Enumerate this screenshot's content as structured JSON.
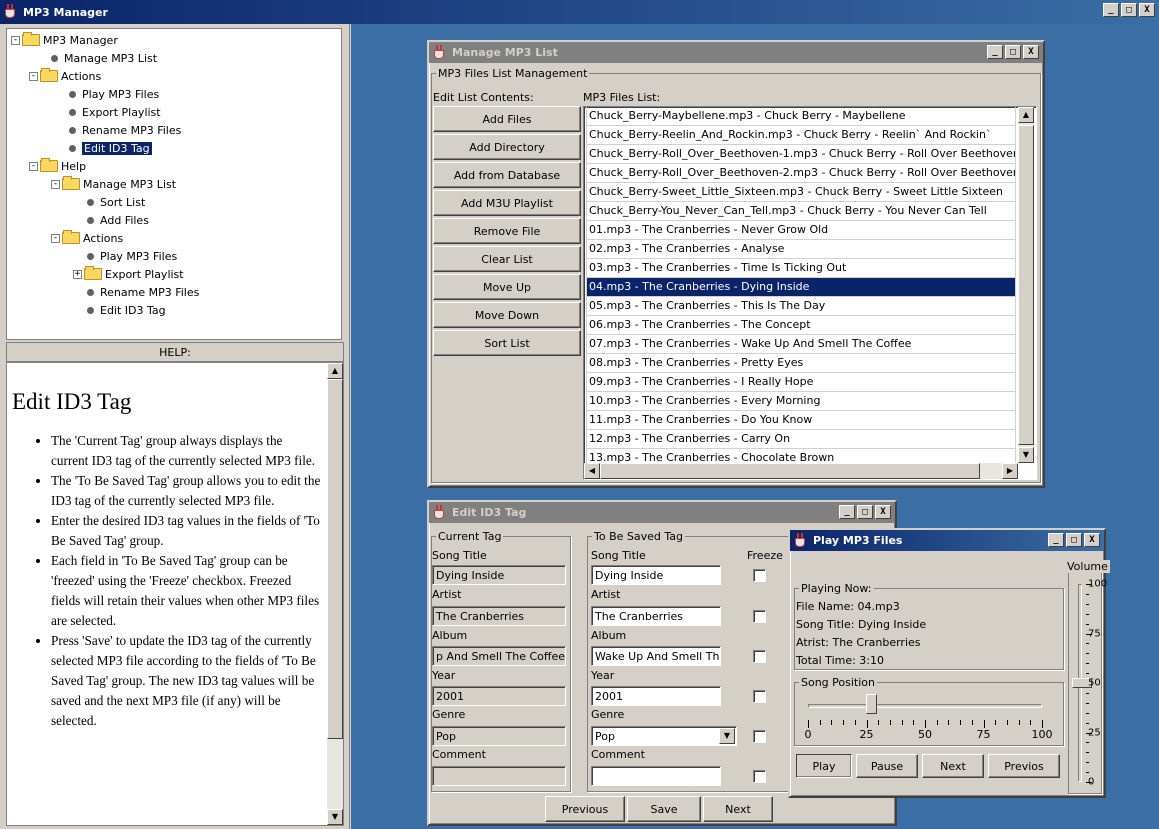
{
  "app": {
    "title": "MP3 Manager",
    "controls": [
      "_",
      "□",
      "X"
    ]
  },
  "tree": {
    "root": "MP3 Manager",
    "items": [
      "Manage MP3 List",
      "Actions",
      "Play MP3 Files",
      "Export Playlist",
      "Rename MP3 Files",
      "Edit ID3 Tag",
      "Help",
      "Manage MP3 List",
      "Sort List",
      "Add Files",
      "Actions",
      "Play MP3 Files",
      "Export Playlist",
      "Rename MP3 Files",
      "Edit ID3 Tag"
    ],
    "expander_minus": "-",
    "expander_plus": "+"
  },
  "help": {
    "header": "HELP:",
    "heading": "Edit ID3 Tag",
    "bullets": [
      "The 'Current Tag' group always displays the current ID3 tag of the currently selected MP3 file.",
      "The 'To Be Saved Tag' group allows you to edit the ID3 tag of the currently selected MP3 file.",
      "Enter the desired ID3 tag values in the fields of 'To Be Saved Tag' group.",
      "Each field in 'To Be Saved Tag' group can be 'freezed' using the 'Freeze' checkbox. Freezed fields will retain their values when other MP3 files are selected.",
      "Press 'Save' to update the ID3 tag of the currently selected MP3 file according to the fields of 'To Be Saved Tag' group. The new ID3 tag values will be saved and the next MP3 file (if any) will be selected."
    ]
  },
  "manage": {
    "title": "Manage MP3 List",
    "group_label": "MP3 Files List Management",
    "edit_label": "Edit List Contents:",
    "list_label": "MP3 Files List:",
    "buttons": [
      "Add Files",
      "Add Directory",
      "Add from Database",
      "Add M3U Playlist",
      "Remove File",
      "Clear List",
      "Move Up",
      "Move Down",
      "Sort List"
    ],
    "files": [
      "Chuck_Berry-Maybellene.mp3 - Chuck Berry - Maybellene",
      "Chuck_Berry-Reelin_And_Rockin.mp3 - Chuck Berry - Reelin` And Rockin`",
      "Chuck_Berry-Roll_Over_Beethoven-1.mp3 - Chuck Berry - Roll Over Beethover",
      "Chuck_Berry-Roll_Over_Beethoven-2.mp3 - Chuck Berry - Roll Over Beethover",
      "Chuck_Berry-Sweet_Little_Sixteen.mp3 - Chuck Berry - Sweet Little Sixteen",
      "Chuck_Berry-You_Never_Can_Tell.mp3 - Chuck Berry - You Never Can Tell",
      "01.mp3 - The Cranberries - Never Grow Old",
      "02.mp3 - The Cranberries - Analyse",
      "03.mp3 - The Cranberries - Time Is Ticking Out",
      "04.mp3 - The Cranberries - Dying Inside",
      "05.mp3 - The Cranberries - This Is The Day",
      "06.mp3 - The Cranberries - The Concept",
      "07.mp3 - The Cranberries - Wake Up And Smell The Coffee",
      "08.mp3 - The Cranberries - Pretty Eyes",
      "09.mp3 - The Cranberries - I Really Hope",
      "10.mp3 - The Cranberries - Every Morning",
      "11.mp3 - The Cranberries - Do You Know",
      "12.mp3 - The Cranberries - Carry On",
      "13.mp3 - The Cranberries - Chocolate Brown"
    ],
    "selected_index": 9
  },
  "id3": {
    "title": "Edit ID3 Tag",
    "current_group": "Current Tag",
    "saved_group": "To Be Saved Tag",
    "freeze_label": "Freeze",
    "fields": [
      {
        "label": "Song Title",
        "current": "Dying Inside",
        "saved": "Dying Inside"
      },
      {
        "label": "Artist",
        "current": "The Cranberries",
        "saved": "The Cranberries"
      },
      {
        "label": "Album",
        "current": "p And Smell The Coffee",
        "saved": "Wake Up And Smell The"
      },
      {
        "label": "Year",
        "current": "2001",
        "saved": "2001"
      },
      {
        "label": "Genre",
        "current": "Pop",
        "saved": "Pop"
      },
      {
        "label": "Comment",
        "current": "",
        "saved": ""
      }
    ],
    "buttons": [
      "Previous",
      "Save",
      "Next"
    ]
  },
  "player": {
    "title": "Play MP3 Files",
    "playing_group": "Playing Now:",
    "file_name": "File Name: 04.mp3",
    "song_title": "Song Title: Dying Inside",
    "artist": "Atrist: The Cranberries",
    "total_time": "Total Time: 3:10",
    "position_group": "Song Position",
    "position_ticks": [
      "0",
      "25",
      "50",
      "75",
      "100"
    ],
    "position_value": 27,
    "volume_group": "Volume",
    "volume_ticks": [
      "100",
      "75",
      "50",
      "25",
      "0"
    ],
    "volume_value": 50,
    "buttons": [
      "Play",
      "Pause",
      "Next",
      "Previos"
    ]
  }
}
